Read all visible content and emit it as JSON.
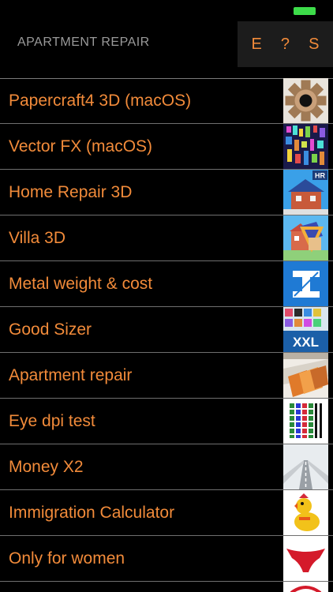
{
  "header": {
    "title": "APARTMENT REPAIR",
    "buttons": [
      {
        "label": "E",
        "name": "e-button"
      },
      {
        "label": "?",
        "name": "help-button"
      },
      {
        "label": "S",
        "name": "s-button"
      }
    ]
  },
  "colors": {
    "accent": "#f28b3a",
    "background": "#000000",
    "battery": "#3ddc4a"
  },
  "apps": [
    {
      "label": "Papercraft4 3D (macOS)",
      "icon": "papercraft-gear-icon"
    },
    {
      "label": "Vector FX (macOS)",
      "icon": "vector-fx-icon"
    },
    {
      "label": "Home Repair 3D",
      "icon": "home-repair-house-icon"
    },
    {
      "label": "Villa 3D",
      "icon": "villa-house-icon"
    },
    {
      "label": "Metal weight & cost",
      "icon": "i-beam-icon"
    },
    {
      "label": "Good Sizer",
      "icon": "good-sizer-xxl-icon"
    },
    {
      "label": "Apartment repair",
      "icon": "apartment-repair-icon"
    },
    {
      "label": "Eye dpi test",
      "icon": "eye-dpi-test-icon"
    },
    {
      "label": "Money X2",
      "icon": "money-x2-road-icon"
    },
    {
      "label": "Immigration Calculator",
      "icon": "immigration-duck-icon"
    },
    {
      "label": "Only for women",
      "icon": "only-for-women-icon"
    }
  ],
  "icon_text": {
    "home_repair_badge": "HR",
    "good_sizer_badge": "XXL"
  }
}
